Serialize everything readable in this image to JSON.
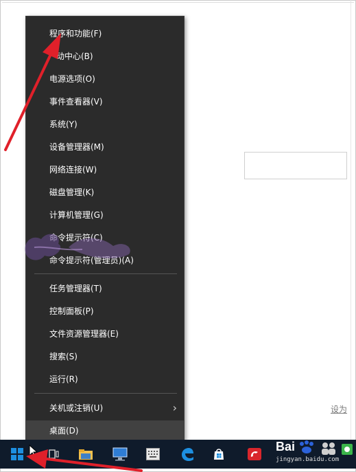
{
  "menu": {
    "items": [
      {
        "label": "程序和功能(F)"
      },
      {
        "label": "动中心(B)"
      },
      {
        "label": "电源选项(O)"
      },
      {
        "label": "事件查看器(V)"
      },
      {
        "label": "系统(Y)"
      },
      {
        "label": "设备管理器(M)"
      },
      {
        "label": "网络连接(W)"
      },
      {
        "label": "磁盘管理(K)"
      },
      {
        "label": "计算机管理(G)"
      },
      {
        "label": "命令提示符(C)"
      },
      {
        "label": "命令提示符(管理员)(A)"
      },
      {
        "label": "任务管理器(T)"
      },
      {
        "label": "控制面板(P)"
      },
      {
        "label": "文件资源管理器(E)"
      },
      {
        "label": "搜索(S)"
      },
      {
        "label": "运行(R)"
      },
      {
        "label": "关机或注销(U)"
      },
      {
        "label": "桌面(D)"
      }
    ]
  },
  "background": {
    "link_text": "设为"
  },
  "watermark": {
    "brand": "Bai",
    "url": "jingyan.baidu.com"
  },
  "colors": {
    "menu_bg": "#2b2b2b",
    "hover_bg": "#414141",
    "arrow": "#e0202a",
    "taskbar": "#0f1b2b",
    "windows_blue": "#1d8fe0"
  },
  "icons": {
    "start": "windows-logo-icon",
    "task_view": "task-view-icon",
    "file_explorer": "folder-icon",
    "edge": "edge-icon",
    "store": "store-icon"
  }
}
